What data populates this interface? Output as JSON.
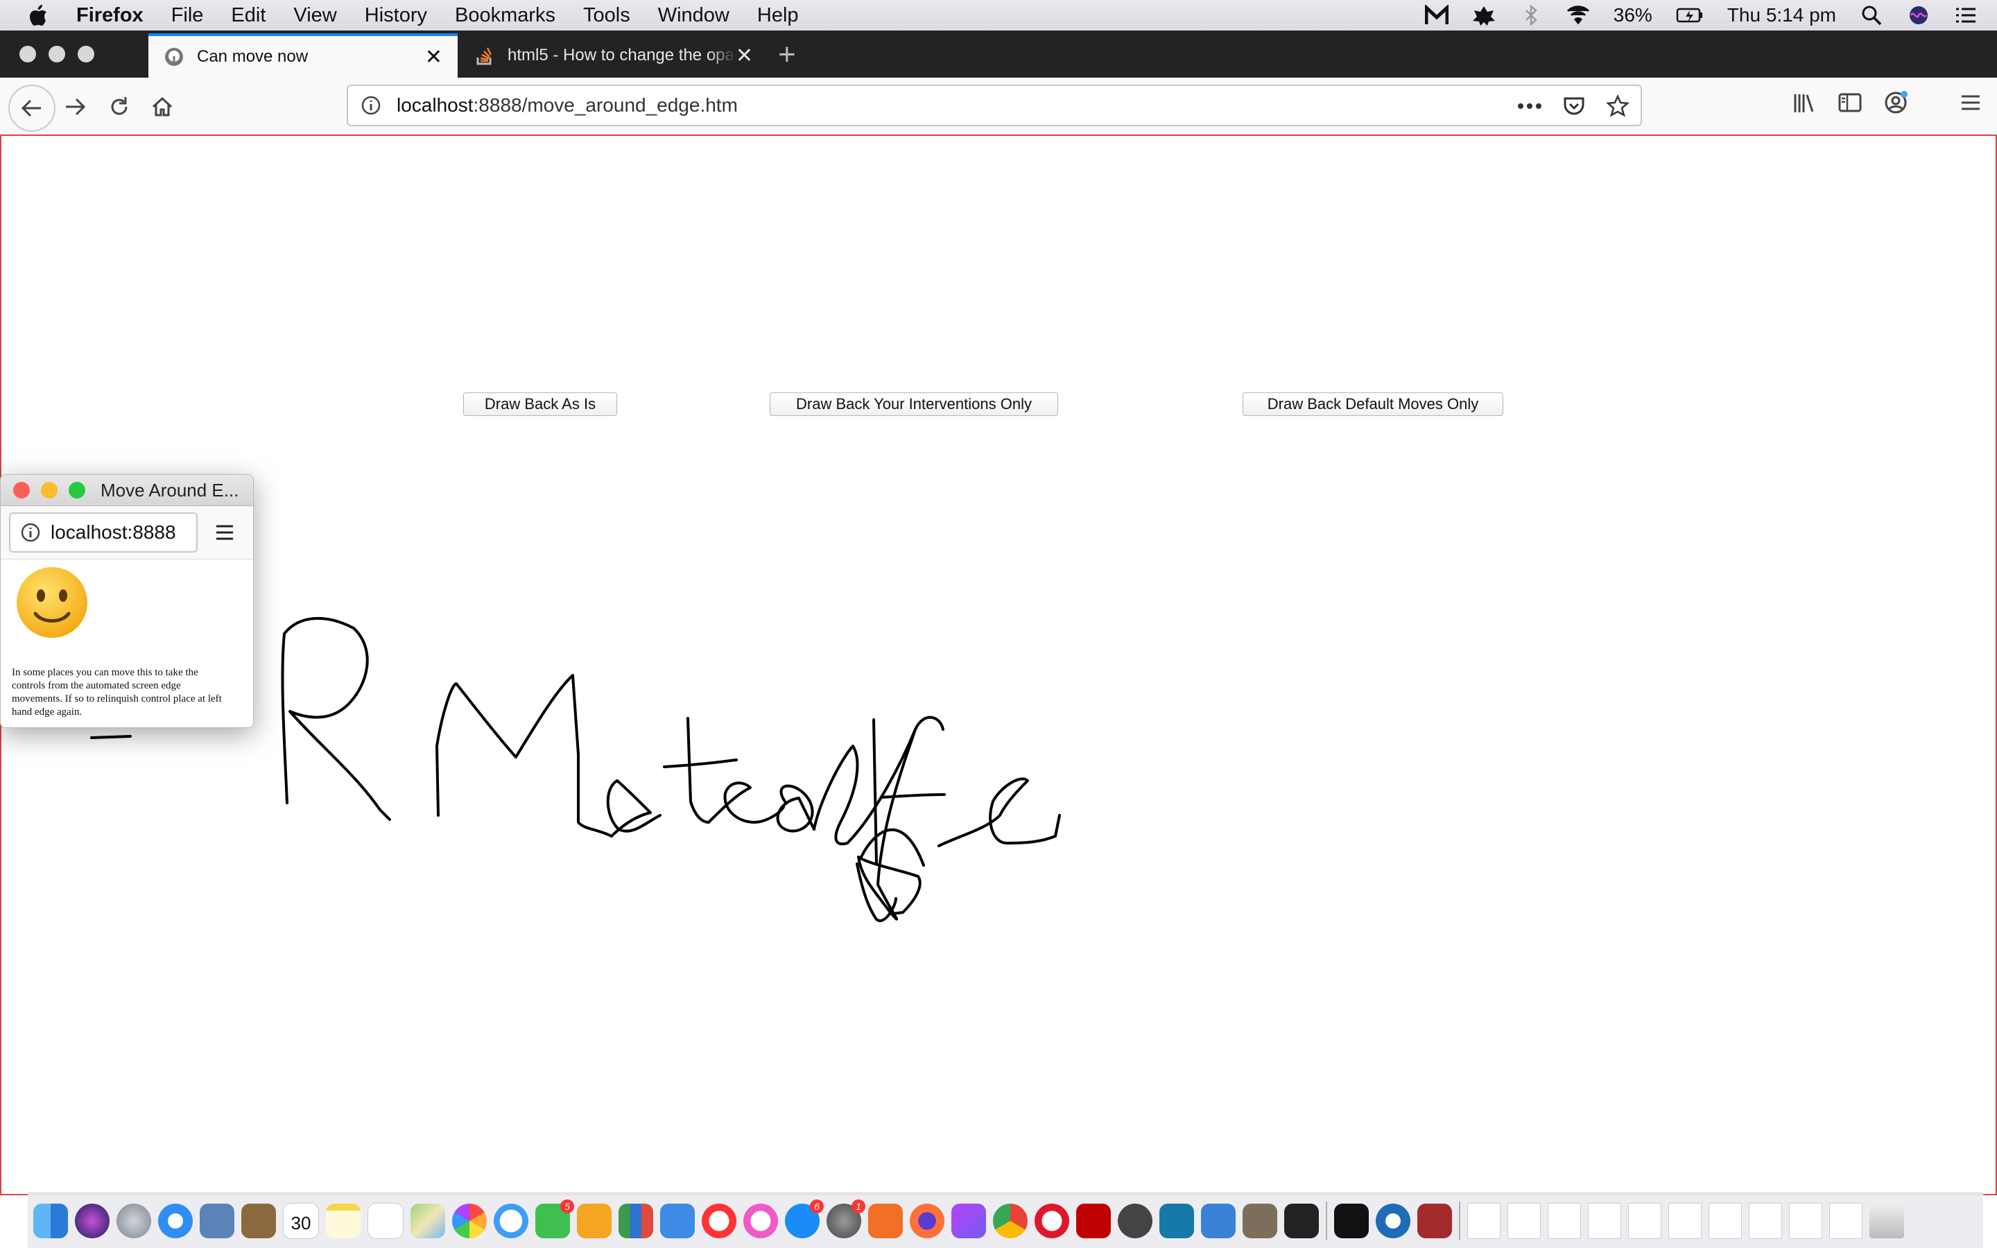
{
  "menubar": {
    "app": "Firefox",
    "items": [
      "File",
      "Edit",
      "View",
      "History",
      "Bookmarks",
      "Tools",
      "Window",
      "Help"
    ],
    "battery": "36%",
    "clock": "Thu 5:14 pm",
    "icons": [
      "apple-icon",
      "malwarebytes-icon",
      "app-icon",
      "bluetooth-icon",
      "wifi-icon",
      "battery-icon",
      "search-icon",
      "siri-icon",
      "list-icon"
    ]
  },
  "tabs": [
    {
      "title": "Can move now",
      "active": true
    },
    {
      "title": "html5 - How to change the opa",
      "active": false
    }
  ],
  "navbar": {
    "url_host": "localhost",
    "url_path": ":8888/move_around_edge.htm"
  },
  "page": {
    "buttons": [
      "Draw Back As Is",
      "Draw Back Your Interventions Only",
      "Draw Back Default Moves Only"
    ]
  },
  "popup": {
    "title": "Move Around E...",
    "url": "localhost:8888",
    "text": "In some places you can move this to take the controls from the automated screen edge movements. If so to relinquish control place at left hand edge again."
  },
  "dock": {
    "badges": [
      "5",
      "6",
      "1"
    ]
  },
  "colors": {
    "tab_accent": "#0a84ff",
    "page_border": "#e04040",
    "close_red": "#fc5f57",
    "min_yellow": "#fdbc2e",
    "max_green": "#28c840"
  }
}
